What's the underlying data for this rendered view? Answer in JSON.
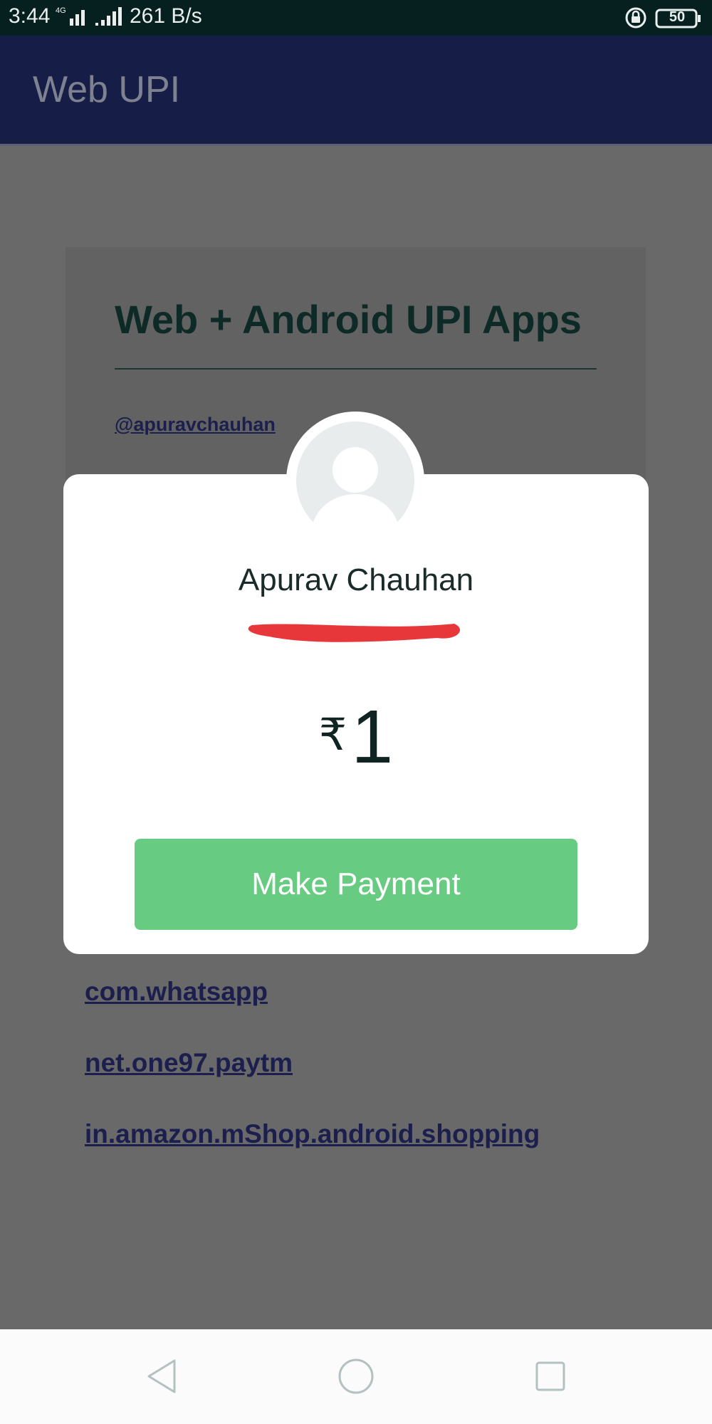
{
  "status_bar": {
    "time": "3:44",
    "network_type": "4G",
    "data_speed": "261 B/s",
    "battery_level": "50",
    "icons": [
      "signal-icon",
      "rotation-lock-icon",
      "battery-icon"
    ]
  },
  "app_bar": {
    "title": "Web UPI"
  },
  "page": {
    "heading": "Web + Android UPI Apps",
    "handle": "@apuravchauhan",
    "packages": [
      "com.whatsapp",
      "net.one97.paytm",
      "in.amazon.mShop.android.shopping"
    ]
  },
  "payment_dialog": {
    "avatar_icon": "person-avatar-icon",
    "payee_name": "Apurav Chauhan",
    "currency_symbol": "₹",
    "amount": "1",
    "pay_button_label": "Make Payment"
  },
  "nav_bar": {
    "buttons": [
      "back-icon",
      "home-icon",
      "recents-icon"
    ]
  },
  "colors": {
    "status_bar": "#05201e",
    "app_bar": "#161d46",
    "overlay": "#696969",
    "pay_button": "#67cc81",
    "redaction": "#e7373b"
  }
}
